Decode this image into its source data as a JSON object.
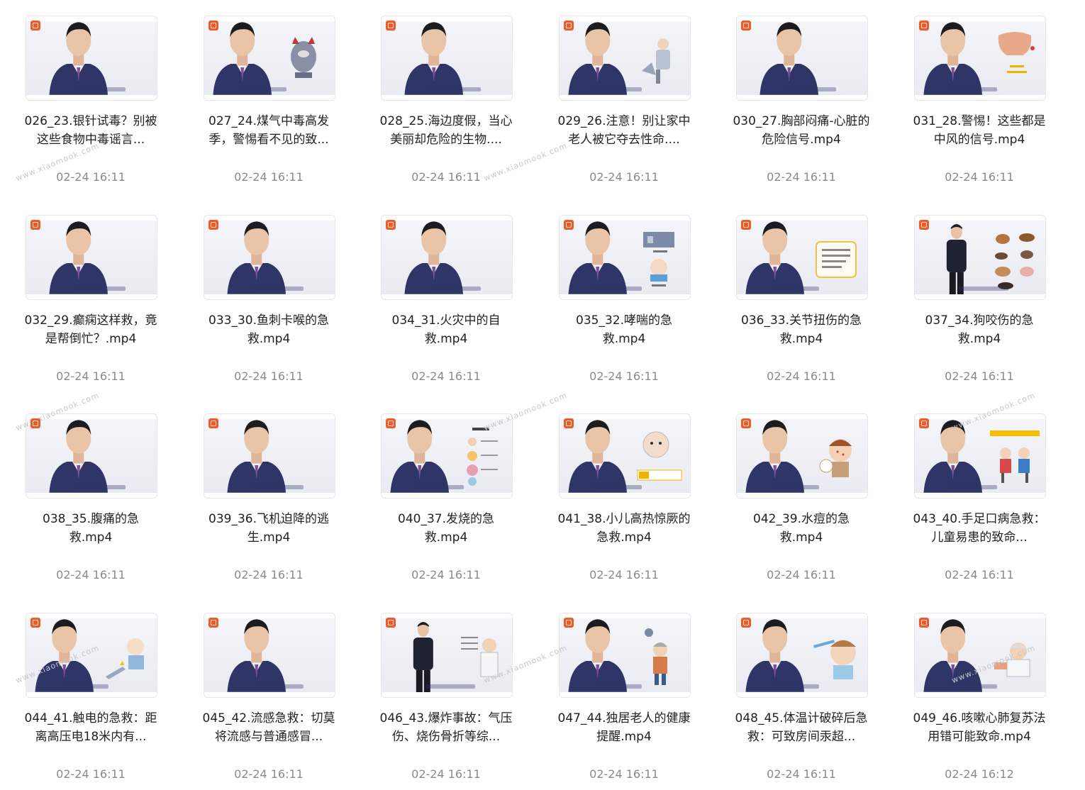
{
  "watermark_text": "www.xiaomook.com",
  "colors": {
    "badge": "#f05a28",
    "title_text": "#222222",
    "time_text": "#8a8a8a",
    "sweater": "#2f3566"
  },
  "videos": [
    {
      "title": "026_23.银针试毒？别被这些食物中毒谣言...",
      "time": "02-24 16:11",
      "illustration": "none"
    },
    {
      "title": "027_24.煤气中毒高发季，警惕看不见的致...",
      "time": "02-24 16:11",
      "illustration": "gas-monster"
    },
    {
      "title": "028_25.海边度假，当心美丽却危险的生物....",
      "time": "02-24 16:11",
      "illustration": "none"
    },
    {
      "title": "029_26.注意！别让家中老人被它夺去性命....",
      "time": "02-24 16:11",
      "illustration": "elderly-fall"
    },
    {
      "title": "030_27.胸部闷痛-心脏的危险信号.mp4",
      "time": "02-24 16:11",
      "illustration": "none"
    },
    {
      "title": "031_28.警惕！这些都是中风的信号.mp4",
      "time": "02-24 16:11",
      "illustration": "face-chart"
    },
    {
      "title": "032_29.癫痫这样救，竟是帮倒忙？.mp4",
      "time": "02-24 16:11",
      "illustration": "none"
    },
    {
      "title": "033_30.鱼刺卡喉的急救.mp4",
      "time": "02-24 16:11",
      "illustration": "none"
    },
    {
      "title": "034_31.火灾中的自救.mp4",
      "time": "02-24 16:11",
      "illustration": "none"
    },
    {
      "title": "035_32.哮喘的急救.mp4",
      "time": "02-24 16:11",
      "illustration": "asthma-triggers"
    },
    {
      "title": "036_33.关节扭伤的急救.mp4",
      "time": "02-24 16:11",
      "illustration": "note-card"
    },
    {
      "title": "037_34.狗咬伤的急救.mp4",
      "time": "02-24 16:11",
      "illustration": "animals"
    },
    {
      "title": "038_35.腹痛的急救.mp4",
      "time": "02-24 16:11",
      "illustration": "none"
    },
    {
      "title": "039_36.飞机迫降的逃生.mp4",
      "time": "02-24 16:11",
      "illustration": "none"
    },
    {
      "title": "040_37.发烧的急救.mp4",
      "time": "02-24 16:11",
      "illustration": "fever-list"
    },
    {
      "title": "041_38.小儿高热惊厥的急救.mp4",
      "time": "02-24 16:11",
      "illustration": "baby"
    },
    {
      "title": "042_39.水痘的急救.mp4",
      "time": "02-24 16:11",
      "illustration": "chickenpox-kid"
    },
    {
      "title": "043_40.手足口病急救：儿童易患的致命...",
      "time": "02-24 16:11",
      "illustration": "kids"
    },
    {
      "title": "044_41.触电的急救：距离高压电18米内有...",
      "time": "02-24 16:11",
      "illustration": "electric"
    },
    {
      "title": "045_42.流感急救：切莫将流感与普通感冒...",
      "time": "02-24 16:11",
      "illustration": "none"
    },
    {
      "title": "046_43.爆炸事故：气压伤、烧伤骨折等综...",
      "time": "02-24 16:11",
      "illustration": "explosion"
    },
    {
      "title": "047_44.独居老人的健康提醒.mp4",
      "time": "02-24 16:11",
      "illustration": "elderly"
    },
    {
      "title": "048_45.体温计破碎后急救：可致房间汞超...",
      "time": "02-24 16:11",
      "illustration": "thermometer"
    },
    {
      "title": "049_46.咳嗽心肺复苏法用错可能致命.mp4",
      "time": "02-24 16:12",
      "illustration": "doctor"
    }
  ]
}
